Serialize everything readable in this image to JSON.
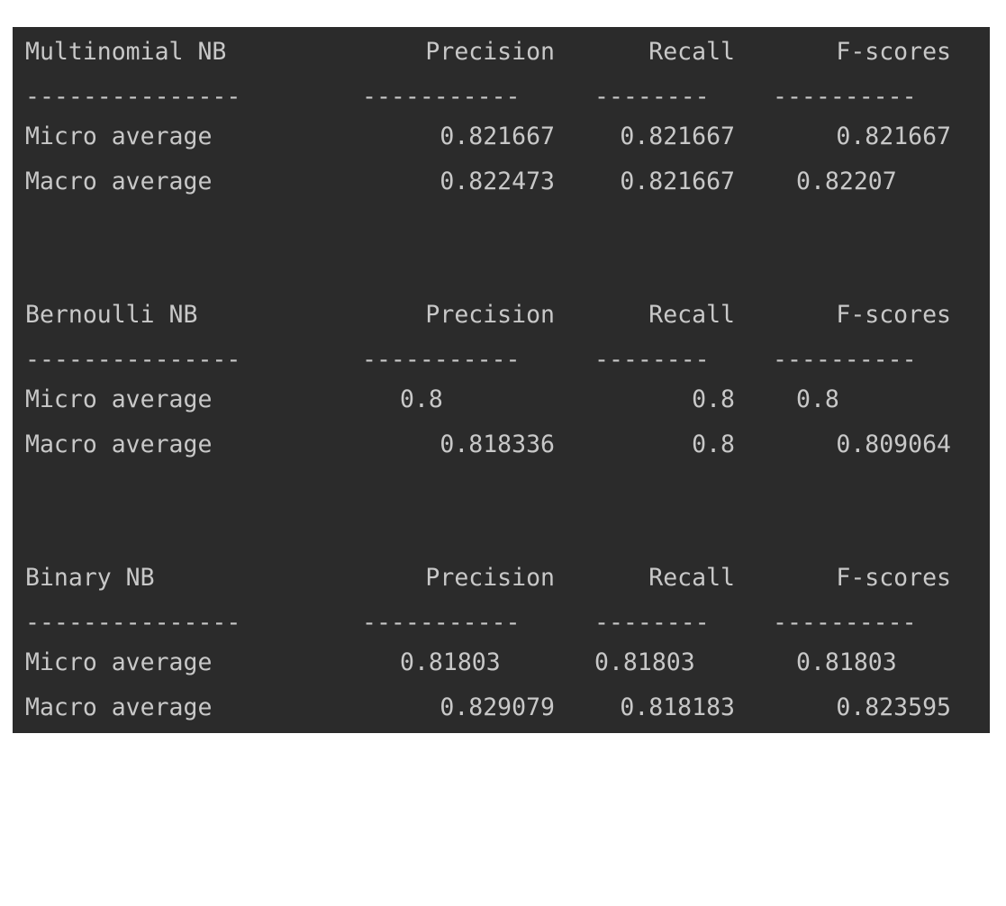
{
  "tables": [
    {
      "header": {
        "model": "Multinomial NB",
        "precision": "Precision",
        "recall": "Recall",
        "fscores": "F-scores"
      },
      "separator": {
        "c0": "---------------",
        "c1": "-----------",
        "c2": "--------",
        "c3": "----------"
      },
      "rows": [
        {
          "label": "Micro average",
          "precision": "0.821667",
          "recall": "0.821667",
          "fscores": "0.821667"
        },
        {
          "label": "Macro average",
          "precision": "0.822473",
          "recall": "0.821667",
          "fscores": "0.82207"
        }
      ]
    },
    {
      "header": {
        "model": "Bernoulli NB",
        "precision": "Precision",
        "recall": "Recall",
        "fscores": "F-scores"
      },
      "separator": {
        "c0": "---------------",
        "c1": "-----------",
        "c2": "--------",
        "c3": "----------"
      },
      "rows": [
        {
          "label": "Micro average",
          "precision": "0.8",
          "recall": "0.8",
          "fscores": "0.8"
        },
        {
          "label": "Macro average",
          "precision": "0.818336",
          "recall": "0.8",
          "fscores": "0.809064"
        }
      ]
    },
    {
      "header": {
        "model": "Binary NB",
        "precision": "Precision",
        "recall": "Recall",
        "fscores": "F-scores"
      },
      "separator": {
        "c0": "---------------",
        "c1": "-----------",
        "c2": "--------",
        "c3": "----------"
      },
      "rows": [
        {
          "label": "Micro average",
          "precision": "0.81803",
          "recall": "0.81803",
          "fscores": "0.81803"
        },
        {
          "label": "Macro average",
          "precision": "0.829079",
          "recall": "0.818183",
          "fscores": "0.823595"
        }
      ]
    }
  ],
  "colors": {
    "background": "#2b2b2b",
    "text": "#c8c8c8"
  }
}
